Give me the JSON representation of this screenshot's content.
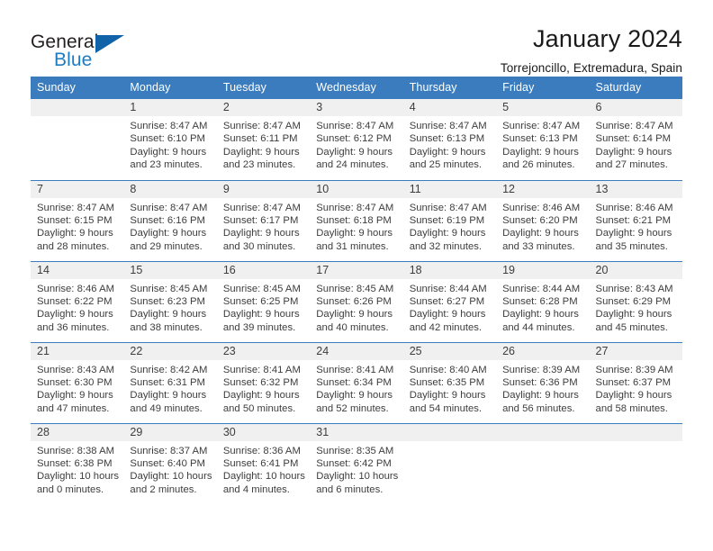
{
  "logo": {
    "word1": "General",
    "word2": "Blue",
    "icon": "triangle-mark",
    "brand_color": "#1f7bc1",
    "triangle_color": "#1063a8"
  },
  "header": {
    "title": "January 2024",
    "subtitle": "Torrejoncillo, Extremadura, Spain"
  },
  "theme": {
    "header_blue": "#3a7cbe",
    "daynum_band": "#f0f0f0",
    "text": "#3d3d3d"
  },
  "calendar": {
    "weekday_headers": [
      "Sunday",
      "Monday",
      "Tuesday",
      "Wednesday",
      "Thursday",
      "Friday",
      "Saturday"
    ],
    "weeks": [
      [
        {
          "day": "",
          "empty": true,
          "l1": "",
          "l2": "",
          "l3": "",
          "l4": ""
        },
        {
          "day": "1",
          "l1": "Sunrise: 8:47 AM",
          "l2": "Sunset: 6:10 PM",
          "l3": "Daylight: 9 hours",
          "l4": "and 23 minutes."
        },
        {
          "day": "2",
          "l1": "Sunrise: 8:47 AM",
          "l2": "Sunset: 6:11 PM",
          "l3": "Daylight: 9 hours",
          "l4": "and 23 minutes."
        },
        {
          "day": "3",
          "l1": "Sunrise: 8:47 AM",
          "l2": "Sunset: 6:12 PM",
          "l3": "Daylight: 9 hours",
          "l4": "and 24 minutes."
        },
        {
          "day": "4",
          "l1": "Sunrise: 8:47 AM",
          "l2": "Sunset: 6:13 PM",
          "l3": "Daylight: 9 hours",
          "l4": "and 25 minutes."
        },
        {
          "day": "5",
          "l1": "Sunrise: 8:47 AM",
          "l2": "Sunset: 6:13 PM",
          "l3": "Daylight: 9 hours",
          "l4": "and 26 minutes."
        },
        {
          "day": "6",
          "l1": "Sunrise: 8:47 AM",
          "l2": "Sunset: 6:14 PM",
          "l3": "Daylight: 9 hours",
          "l4": "and 27 minutes."
        }
      ],
      [
        {
          "day": "7",
          "l1": "Sunrise: 8:47 AM",
          "l2": "Sunset: 6:15 PM",
          "l3": "Daylight: 9 hours",
          "l4": "and 28 minutes."
        },
        {
          "day": "8",
          "l1": "Sunrise: 8:47 AM",
          "l2": "Sunset: 6:16 PM",
          "l3": "Daylight: 9 hours",
          "l4": "and 29 minutes."
        },
        {
          "day": "9",
          "l1": "Sunrise: 8:47 AM",
          "l2": "Sunset: 6:17 PM",
          "l3": "Daylight: 9 hours",
          "l4": "and 30 minutes."
        },
        {
          "day": "10",
          "l1": "Sunrise: 8:47 AM",
          "l2": "Sunset: 6:18 PM",
          "l3": "Daylight: 9 hours",
          "l4": "and 31 minutes."
        },
        {
          "day": "11",
          "l1": "Sunrise: 8:47 AM",
          "l2": "Sunset: 6:19 PM",
          "l3": "Daylight: 9 hours",
          "l4": "and 32 minutes."
        },
        {
          "day": "12",
          "l1": "Sunrise: 8:46 AM",
          "l2": "Sunset: 6:20 PM",
          "l3": "Daylight: 9 hours",
          "l4": "and 33 minutes."
        },
        {
          "day": "13",
          "l1": "Sunrise: 8:46 AM",
          "l2": "Sunset: 6:21 PM",
          "l3": "Daylight: 9 hours",
          "l4": "and 35 minutes."
        }
      ],
      [
        {
          "day": "14",
          "l1": "Sunrise: 8:46 AM",
          "l2": "Sunset: 6:22 PM",
          "l3": "Daylight: 9 hours",
          "l4": "and 36 minutes."
        },
        {
          "day": "15",
          "l1": "Sunrise: 8:45 AM",
          "l2": "Sunset: 6:23 PM",
          "l3": "Daylight: 9 hours",
          "l4": "and 38 minutes."
        },
        {
          "day": "16",
          "l1": "Sunrise: 8:45 AM",
          "l2": "Sunset: 6:25 PM",
          "l3": "Daylight: 9 hours",
          "l4": "and 39 minutes."
        },
        {
          "day": "17",
          "l1": "Sunrise: 8:45 AM",
          "l2": "Sunset: 6:26 PM",
          "l3": "Daylight: 9 hours",
          "l4": "and 40 minutes."
        },
        {
          "day": "18",
          "l1": "Sunrise: 8:44 AM",
          "l2": "Sunset: 6:27 PM",
          "l3": "Daylight: 9 hours",
          "l4": "and 42 minutes."
        },
        {
          "day": "19",
          "l1": "Sunrise: 8:44 AM",
          "l2": "Sunset: 6:28 PM",
          "l3": "Daylight: 9 hours",
          "l4": "and 44 minutes."
        },
        {
          "day": "20",
          "l1": "Sunrise: 8:43 AM",
          "l2": "Sunset: 6:29 PM",
          "l3": "Daylight: 9 hours",
          "l4": "and 45 minutes."
        }
      ],
      [
        {
          "day": "21",
          "l1": "Sunrise: 8:43 AM",
          "l2": "Sunset: 6:30 PM",
          "l3": "Daylight: 9 hours",
          "l4": "and 47 minutes."
        },
        {
          "day": "22",
          "l1": "Sunrise: 8:42 AM",
          "l2": "Sunset: 6:31 PM",
          "l3": "Daylight: 9 hours",
          "l4": "and 49 minutes."
        },
        {
          "day": "23",
          "l1": "Sunrise: 8:41 AM",
          "l2": "Sunset: 6:32 PM",
          "l3": "Daylight: 9 hours",
          "l4": "and 50 minutes."
        },
        {
          "day": "24",
          "l1": "Sunrise: 8:41 AM",
          "l2": "Sunset: 6:34 PM",
          "l3": "Daylight: 9 hours",
          "l4": "and 52 minutes."
        },
        {
          "day": "25",
          "l1": "Sunrise: 8:40 AM",
          "l2": "Sunset: 6:35 PM",
          "l3": "Daylight: 9 hours",
          "l4": "and 54 minutes."
        },
        {
          "day": "26",
          "l1": "Sunrise: 8:39 AM",
          "l2": "Sunset: 6:36 PM",
          "l3": "Daylight: 9 hours",
          "l4": "and 56 minutes."
        },
        {
          "day": "27",
          "l1": "Sunrise: 8:39 AM",
          "l2": "Sunset: 6:37 PM",
          "l3": "Daylight: 9 hours",
          "l4": "and 58 minutes."
        }
      ],
      [
        {
          "day": "28",
          "l1": "Sunrise: 8:38 AM",
          "l2": "Sunset: 6:38 PM",
          "l3": "Daylight: 10 hours",
          "l4": "and 0 minutes."
        },
        {
          "day": "29",
          "l1": "Sunrise: 8:37 AM",
          "l2": "Sunset: 6:40 PM",
          "l3": "Daylight: 10 hours",
          "l4": "and 2 minutes."
        },
        {
          "day": "30",
          "l1": "Sunrise: 8:36 AM",
          "l2": "Sunset: 6:41 PM",
          "l3": "Daylight: 10 hours",
          "l4": "and 4 minutes."
        },
        {
          "day": "31",
          "l1": "Sunrise: 8:35 AM",
          "l2": "Sunset: 6:42 PM",
          "l3": "Daylight: 10 hours",
          "l4": "and 6 minutes."
        },
        {
          "day": "",
          "empty": true,
          "l1": "",
          "l2": "",
          "l3": "",
          "l4": ""
        },
        {
          "day": "",
          "empty": true,
          "l1": "",
          "l2": "",
          "l3": "",
          "l4": ""
        },
        {
          "day": "",
          "empty": true,
          "l1": "",
          "l2": "",
          "l3": "",
          "l4": ""
        }
      ]
    ]
  }
}
